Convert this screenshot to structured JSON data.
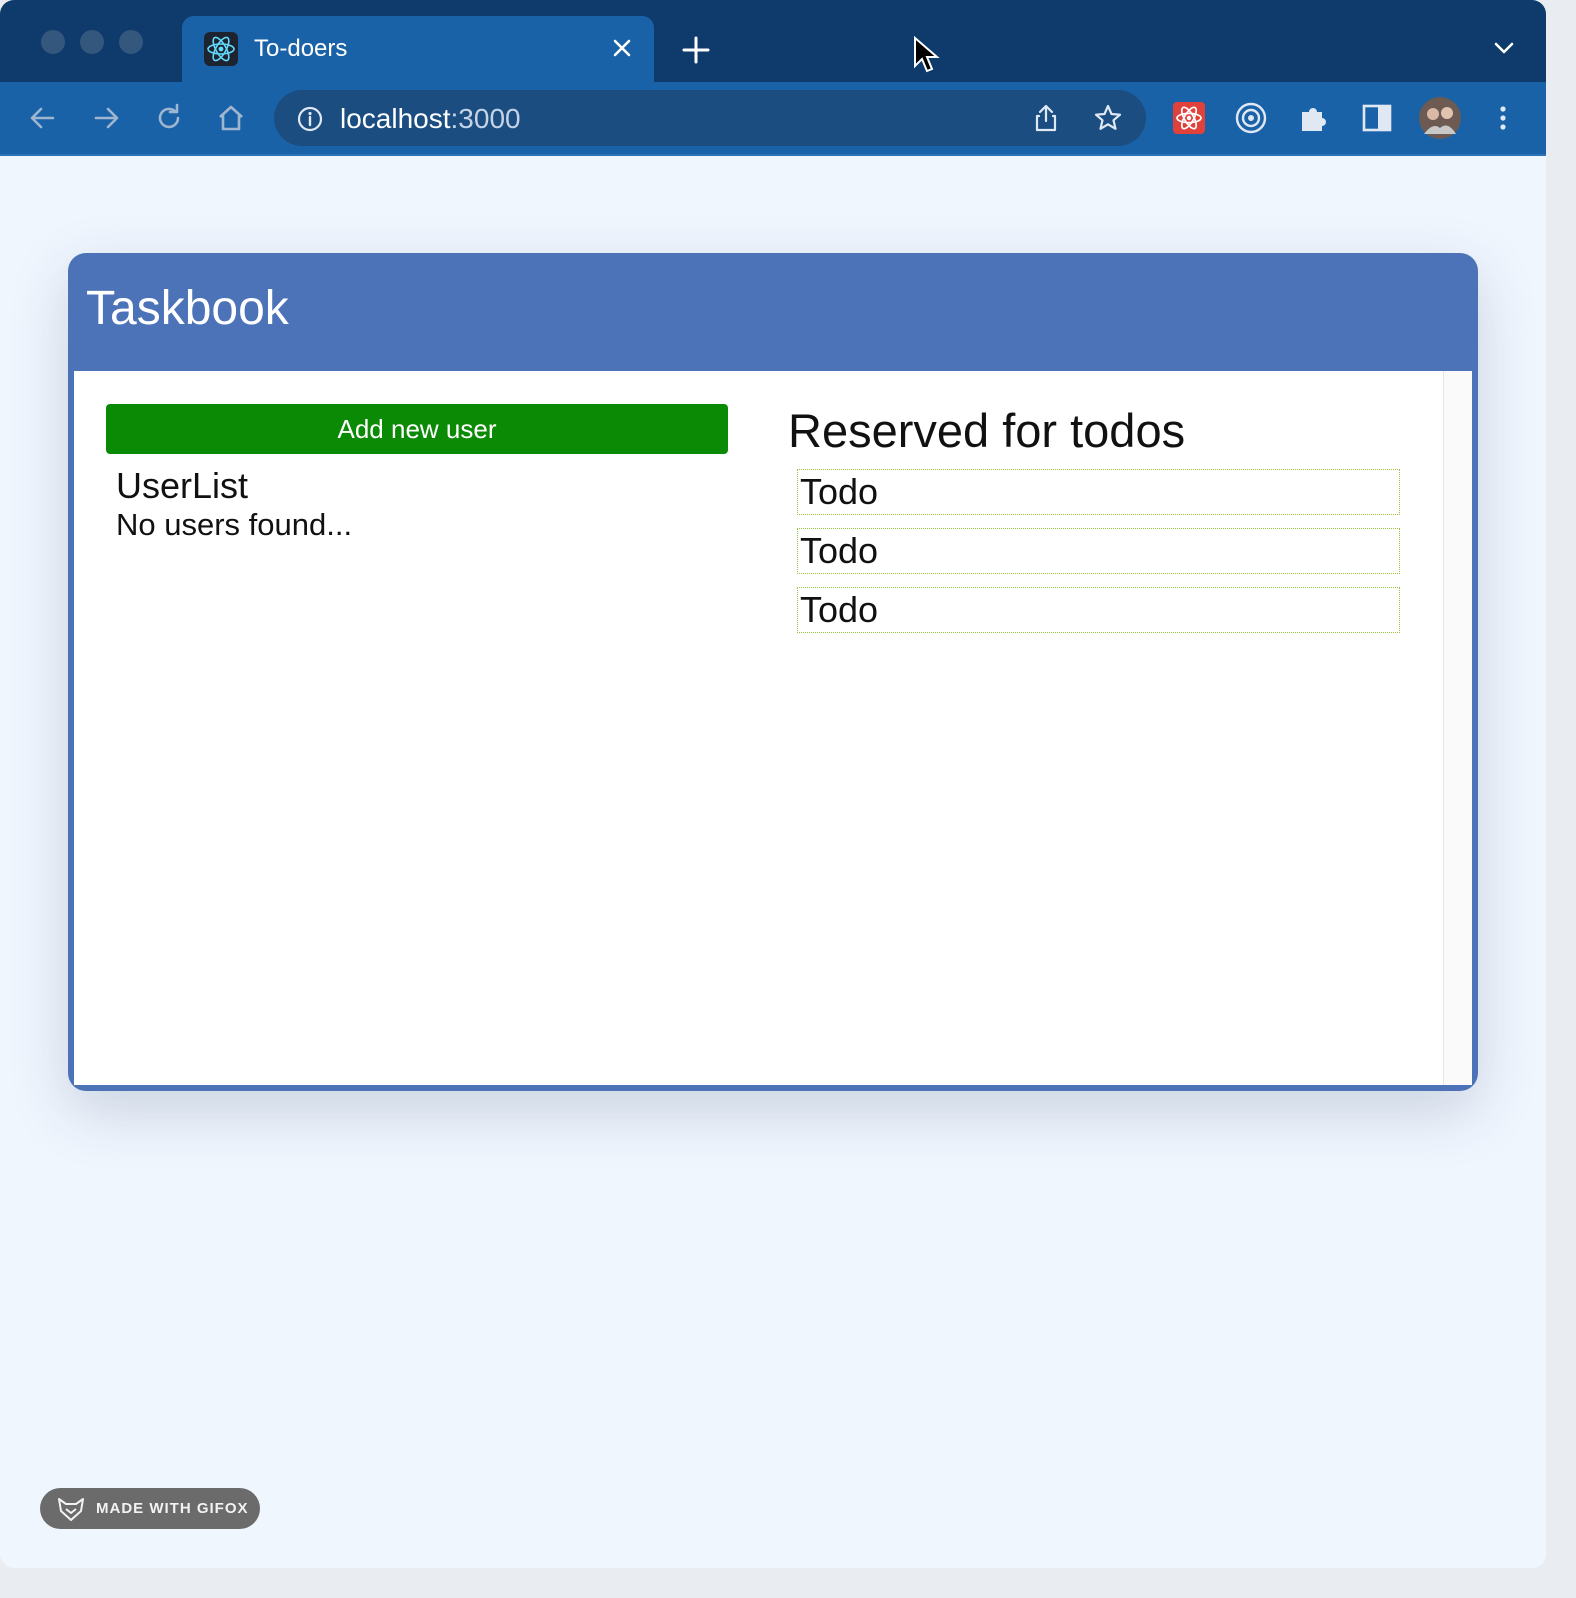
{
  "browser": {
    "tab": {
      "title": "To-doers",
      "favicon": "react-atom-icon",
      "close_icon": "close-icon"
    },
    "new_tab_icon": "plus-icon",
    "tab_search_icon": "chevron-down-icon",
    "nav": {
      "back_icon": "arrow-left-icon",
      "forward_icon": "arrow-right-icon",
      "reload_icon": "reload-icon",
      "home_icon": "home-icon"
    },
    "omnibox": {
      "info_icon": "info-icon",
      "host": "localhost",
      "port": ":3000"
    },
    "actions": [
      "share-icon",
      "bookmark-star-icon",
      "react-devtools-icon",
      "extension-target-icon",
      "extensions-puzzle-icon",
      "side-panel-icon",
      "profile-avatar",
      "kebab-menu-icon"
    ]
  },
  "app": {
    "title": "Taskbook",
    "add_user_label": "Add new user",
    "userlist_title": "UserList",
    "userlist_empty": "No users found...",
    "todos_title": "Reserved for todos",
    "todos": [
      "Todo",
      "Todo",
      "Todo"
    ]
  },
  "watermark": {
    "text": "MADE WITH GIFOX",
    "icon": "gifox-fox-icon"
  },
  "colors": {
    "browser_frame": "#0e3b6c",
    "toolbar": "#1a62a8",
    "card_header": "#4c72b8",
    "add_button": "#0b8a06",
    "todo_border": "#97c23c"
  }
}
